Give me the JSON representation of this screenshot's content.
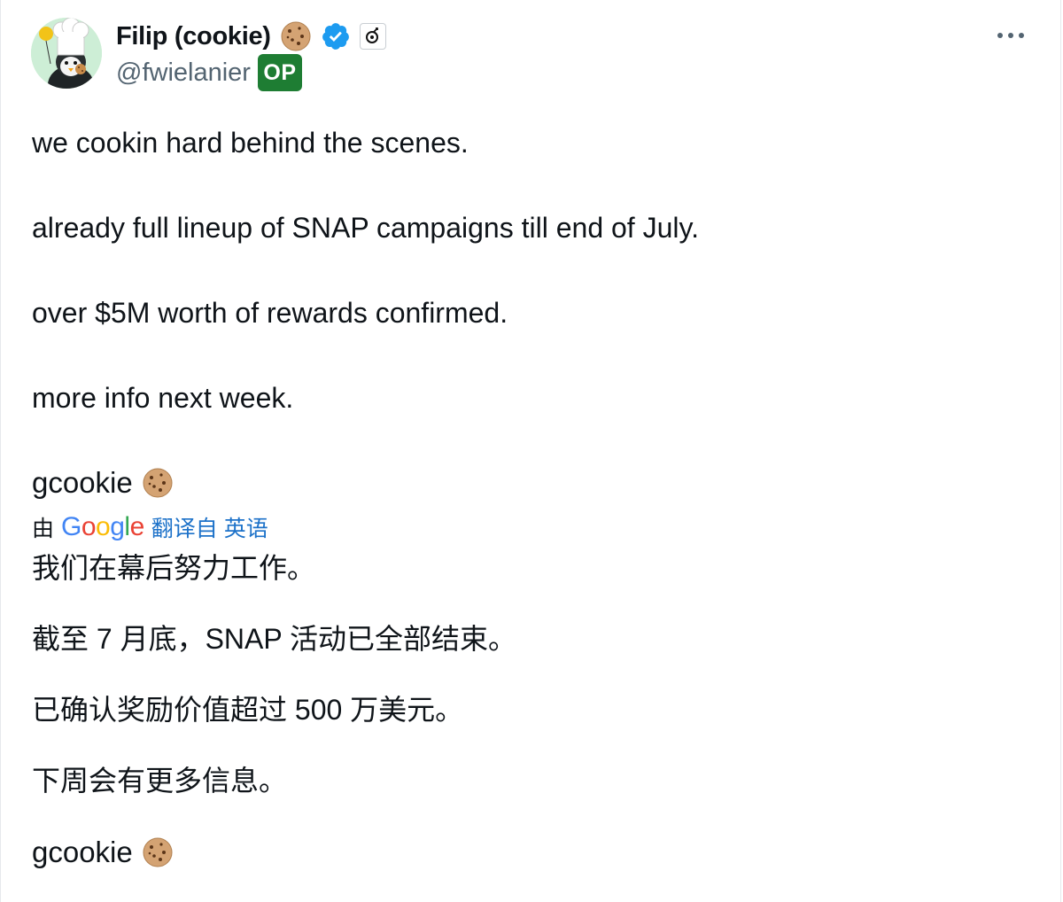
{
  "post": {
    "author": {
      "display_name": "Filip (cookie)",
      "handle": "@fwielanier",
      "badge": "OP",
      "badge_color": "#1e7d33",
      "verified_color": "#1d9bf0",
      "icons": [
        "cookie-icon",
        "verified-badge-icon",
        "affiliate-badge-icon"
      ]
    },
    "more_menu_icon": "more-horizontal-icon",
    "lines": [
      "we cookin hard behind the scenes.",
      "already full lineup of SNAP campaigns till end of July.",
      "over $5M worth of rewards confirmed.",
      "more info next week."
    ],
    "signature": "gcookie",
    "translation": {
      "by_label": "由",
      "provider": "Google",
      "link_text": "翻译自 英语",
      "lines": [
        "我们在幕后努力工作。",
        "截至 7 月底，SNAP 活动已全部结束。",
        "已确认奖励价值超过 500 万美元。",
        "下周会有更多信息。"
      ],
      "signature": "gcookie"
    }
  }
}
